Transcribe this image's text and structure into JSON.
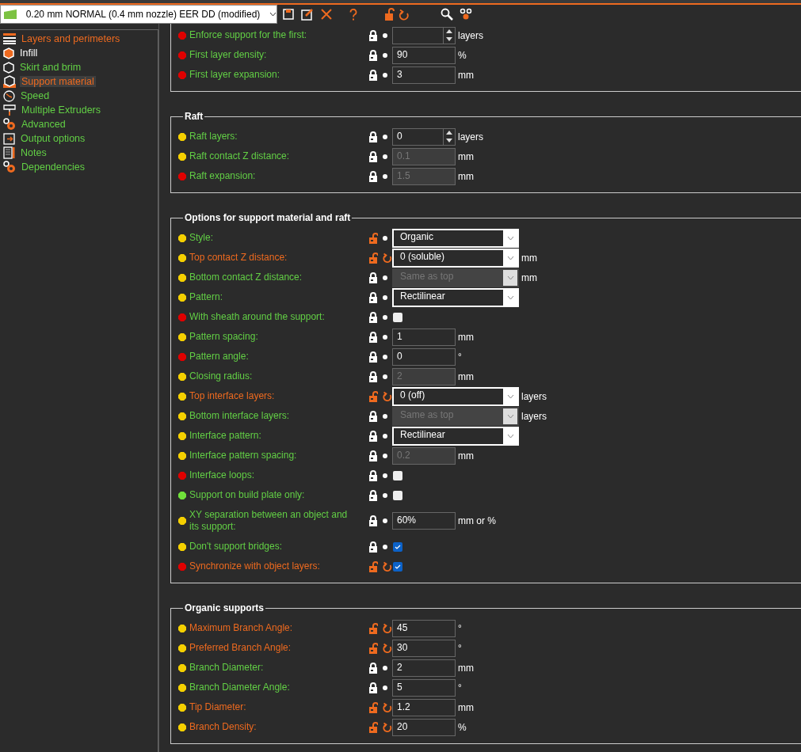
{
  "preset": {
    "name": "0.20 mm NORMAL (0.4 mm nozzle) EER DD (modified)"
  },
  "sidebar": {
    "items": [
      {
        "label": "Layers and perimeters",
        "color": "#ee6a1f",
        "selected": false
      },
      {
        "label": "Infill",
        "color": "#ffffff",
        "selected": false
      },
      {
        "label": "Skirt and brim",
        "color": "#62cf45",
        "selected": false
      },
      {
        "label": "Support material",
        "color": "#ee6a1f",
        "selected": true
      },
      {
        "label": "Speed",
        "color": "#62cf45",
        "selected": false
      },
      {
        "label": "Multiple Extruders",
        "color": "#62cf45",
        "selected": false
      },
      {
        "label": "Advanced",
        "color": "#62cf45",
        "selected": false
      },
      {
        "label": "Output options",
        "color": "#62cf45",
        "selected": false
      },
      {
        "label": "Notes",
        "color": "#62cf45",
        "selected": false
      },
      {
        "label": "Dependencies",
        "color": "#62cf45",
        "selected": false
      }
    ]
  },
  "sections": [
    {
      "cut": true,
      "rows": [
        {
          "label": "Enforce support for the first:",
          "color": "#e00000",
          "modified": false,
          "kind": "spin",
          "unit": "layers"
        },
        {
          "label": "First layer density:",
          "color": "#e00000",
          "modified": false,
          "kind": "number",
          "value": "90",
          "unit": "%",
          "disabled": false
        },
        {
          "label": "First layer expansion:",
          "color": "#e00000",
          "modified": false,
          "kind": "number",
          "value": "3",
          "unit": "mm",
          "disabled": false
        }
      ]
    },
    {
      "title": "Raft",
      "rows": [
        {
          "label": "Raft layers:",
          "color": "#f5d000",
          "modified": false,
          "kind": "spin",
          "value": "0",
          "unit": "layers"
        },
        {
          "label": "Raft contact Z distance:",
          "color": "#f5d000",
          "modified": false,
          "kind": "number",
          "value": "0.1",
          "unit": "mm",
          "disabled": true
        },
        {
          "label": "Raft expansion:",
          "color": "#e00000",
          "modified": false,
          "kind": "number",
          "value": "1.5",
          "unit": "mm",
          "disabled": true
        }
      ]
    },
    {
      "title": "Options for support material and raft",
      "rows": [
        {
          "label": "Style:",
          "color": "#f5d000",
          "modified": false,
          "unlocked": true,
          "kind": "select",
          "value": "Organic",
          "disabled": false
        },
        {
          "label": "Top contact Z distance:",
          "color": "#f5d000",
          "modified": true,
          "kind": "select",
          "value": "0 (soluble)",
          "unit": "mm",
          "disabled": false
        },
        {
          "label": "Bottom contact Z distance:",
          "color": "#f5d000",
          "modified": false,
          "kind": "select",
          "value": "Same as top",
          "unit": "mm",
          "disabled": true
        },
        {
          "label": "Pattern:",
          "color": "#f5d000",
          "modified": false,
          "kind": "select",
          "value": "Rectilinear",
          "disabled": false
        },
        {
          "label": "With sheath around the support:",
          "color": "#e00000",
          "modified": false,
          "kind": "checkbox",
          "checked": false
        },
        {
          "label": "Pattern spacing:",
          "color": "#f5d000",
          "modified": false,
          "kind": "number",
          "value": "1",
          "unit": "mm",
          "disabled": false
        },
        {
          "label": "Pattern angle:",
          "color": "#e00000",
          "modified": false,
          "kind": "number",
          "value": "0",
          "unit": "°",
          "disabled": false
        },
        {
          "label": "Closing radius:",
          "color": "#f5d000",
          "modified": false,
          "kind": "number",
          "value": "2",
          "unit": "mm",
          "disabled": true
        },
        {
          "label": "Top interface layers:",
          "color": "#f5d000",
          "modified": true,
          "kind": "select",
          "value": "0 (off)",
          "unit": "layers",
          "disabled": false
        },
        {
          "label": "Bottom interface layers:",
          "color": "#f5d000",
          "modified": false,
          "kind": "select",
          "value": "Same as top",
          "unit": "layers",
          "disabled": true
        },
        {
          "label": "Interface pattern:",
          "color": "#f5d000",
          "modified": false,
          "kind": "select",
          "value": "Rectilinear",
          "disabled": false
        },
        {
          "label": "Interface pattern spacing:",
          "color": "#f5d000",
          "modified": false,
          "kind": "number",
          "value": "0.2",
          "unit": "mm",
          "disabled": true
        },
        {
          "label": "Interface loops:",
          "color": "#e00000",
          "modified": false,
          "kind": "checkbox",
          "checked": false
        },
        {
          "label": "Support on build plate only:",
          "color": "#6fe03a",
          "modified": false,
          "kind": "checkbox",
          "checked": false
        },
        {
          "label": "XY separation between an object and its support:",
          "color": "#f5d000",
          "modified": false,
          "kind": "number",
          "value": "60%",
          "unit": "mm or %",
          "disabled": false
        },
        {
          "label": "Don't support bridges:",
          "color": "#f5d000",
          "modified": false,
          "kind": "checkbox",
          "checked": true
        },
        {
          "label": "Synchronize with object layers:",
          "color": "#e00000",
          "modified": true,
          "kind": "checkbox",
          "checked": true
        }
      ]
    },
    {
      "title": "Organic supports",
      "rows": [
        {
          "label": "Maximum Branch Angle:",
          "color": "#f5d000",
          "modified": true,
          "kind": "number",
          "value": "45",
          "unit": "°",
          "disabled": false
        },
        {
          "label": "Preferred Branch Angle:",
          "color": "#f5d000",
          "modified": true,
          "kind": "number",
          "value": "30",
          "unit": "°",
          "disabled": false
        },
        {
          "label": "Branch Diameter:",
          "color": "#f5d000",
          "modified": false,
          "kind": "number",
          "value": "2",
          "unit": "mm",
          "disabled": false
        },
        {
          "label": "Branch Diameter Angle:",
          "color": "#f5d000",
          "modified": false,
          "kind": "number",
          "value": "5",
          "unit": "°",
          "disabled": false
        },
        {
          "label": "Tip Diameter:",
          "color": "#f5d000",
          "modified": true,
          "kind": "number",
          "value": "1.2",
          "unit": "mm",
          "disabled": false
        },
        {
          "label": "Branch Density:",
          "color": "#f5d000",
          "modified": true,
          "kind": "number",
          "value": "20",
          "unit": "%",
          "disabled": false
        }
      ]
    }
  ]
}
